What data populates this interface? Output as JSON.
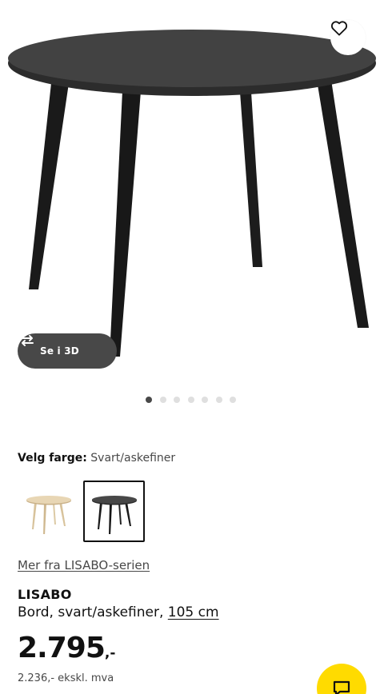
{
  "gallery": {
    "view_3d_label": "Se i 3D",
    "slide_count": 7,
    "active_slide": 1,
    "favourite_icon": "heart-outline-icon",
    "rotate_icon": "rotate-3d-icon"
  },
  "color_picker": {
    "label": "Velg farge:",
    "selected_value": "Svart/askefiner",
    "options": [
      {
        "name": "birch-veneer-swatch",
        "selected": false
      },
      {
        "name": "black-ash-veneer-swatch",
        "selected": true
      }
    ]
  },
  "series_link": "Mer fra LISABO-serien",
  "product": {
    "name": "LISABO",
    "description": "Bord, svart/askefiner,",
    "size": "105 cm"
  },
  "price": {
    "integer": "2.795",
    "decimal": ",-",
    "ex_vat": "2.236,- ekskl. mva"
  },
  "colors": {
    "accent_yellow": "#ffdb00",
    "dark_grey": "#484848",
    "text": "#111111"
  },
  "chat_icon": "chat-bubble-icon"
}
